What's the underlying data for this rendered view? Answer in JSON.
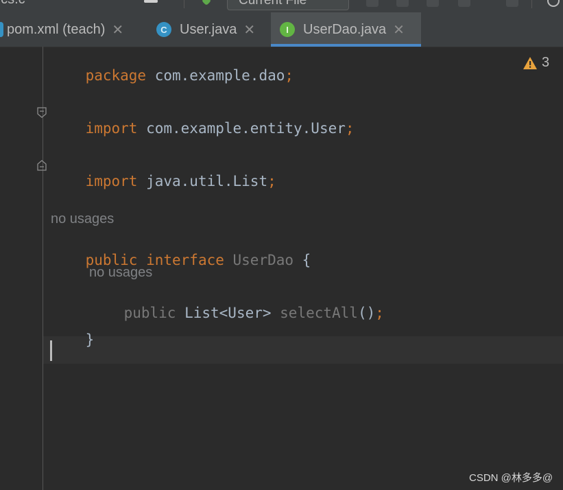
{
  "toolbar": {
    "left_text": "t.cs.c",
    "run_config": "Current File"
  },
  "tabs": [
    {
      "label": "pom.xml (teach)",
      "icon": "maven-icon",
      "active": false
    },
    {
      "label": "User.java",
      "icon": "class-icon",
      "icon_letter": "C",
      "active": false
    },
    {
      "label": "UserDao.java",
      "icon": "interface-icon",
      "icon_letter": "I",
      "active": true
    }
  ],
  "editor": {
    "line1": {
      "kw": "package",
      "text": " com.example.dao",
      "semi": ";"
    },
    "line2": {
      "kw": "import",
      "text": " com.example.entity.User",
      "semi": ";"
    },
    "line3": {
      "kw": "import",
      "text": " java.util.List",
      "semi": ";"
    },
    "hint_interface": "no usages",
    "line4": {
      "kw1": "public",
      "kw2": " interface",
      "name": " UserDao",
      "brace": " {"
    },
    "hint_method": "no usages",
    "line5": {
      "mod": "public",
      "type": " List<User>",
      "name": " selectAll",
      "parens": "()",
      "semi": ";"
    },
    "line6": "}"
  },
  "inspection": {
    "warning_count": "3"
  },
  "watermark": "CSDN @林多多@",
  "colors": {
    "keyword": "#cc7832",
    "plain": "#a9b7c6",
    "unused": "#787878",
    "accent": "#4a88c7",
    "warning": "#e8a33d"
  }
}
